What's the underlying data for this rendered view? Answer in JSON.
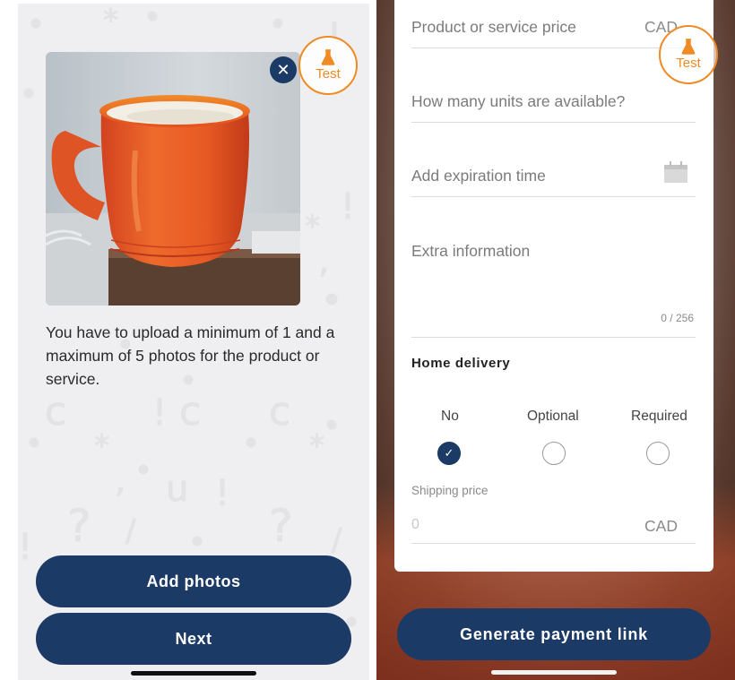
{
  "left": {
    "test_badge": "Test",
    "remove_icon": "close-icon",
    "photo_alt": "orange mug photo",
    "info_text": "You have to upload a minimum of 1 and a maximum of 5 photos for the product or service.",
    "add_photos_label": "Add photos",
    "next_label": "Next"
  },
  "right": {
    "test_badge": "Test",
    "price_label": "Product or service price",
    "price_currency": "CAD",
    "units_label": "How many units are available?",
    "expiration_label": "Add expiration time",
    "expiration_icon": "calendar-icon",
    "extra_label": "Extra information",
    "extra_counter": "0 / 256",
    "delivery_title": "Home delivery",
    "delivery_options": [
      {
        "label": "No",
        "selected": true
      },
      {
        "label": "Optional",
        "selected": false
      },
      {
        "label": "Required",
        "selected": false
      }
    ],
    "shipping_label": "Shipping price",
    "shipping_value": "0",
    "shipping_currency": "CAD",
    "generate_label": "Generate payment link"
  },
  "colors": {
    "primary": "#1c3a66",
    "accent": "#f08a22"
  }
}
